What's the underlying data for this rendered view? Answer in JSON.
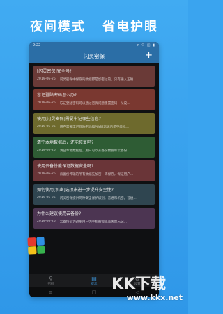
{
  "banner": {
    "left": "夜间模式",
    "right": "省电护眼"
  },
  "status": {
    "time": "9:22",
    "icons": "▾ ⌔ ◫ ▮"
  },
  "appbar": {
    "title": "闪灵密保",
    "add": "+"
  },
  "cards": [
    {
      "color": "#6a3a37",
      "question": "[闪灵密保]安全吗?",
      "date": "2019-06-26",
      "snippet": "闪灵密保中保存的数据都是加密过的，只有输入正确..."
    },
    {
      "color": "#7a3830",
      "question": "忘记登陆密码怎么办?",
      "date": "2019-06-26",
      "snippet": "忘记登陆密码可以通过密保问题重置密码，从设..."
    },
    {
      "color": "#6e6a2d",
      "question": "使用[闪灵密保]需要牢记哪些信息?",
      "date": "2019-06-26",
      "snippet": "用户需要牢记登陆密码和PIN码忘记后是不能找..."
    },
    {
      "color": "#2e5c34",
      "question": "清空本地数据后，还能恢复吗?",
      "date": "2019-06-26",
      "snippet": "清空本地数据后，用户可以从备份数据和云备份..."
    },
    {
      "color": "#6a3538",
      "question": "使用云备份能保证数据安全吗?",
      "date": "2019-06-26",
      "snippet": "云备份传输的所有数据先加密，再保存，保证用户..."
    },
    {
      "color": "#2f4550",
      "question": "如何使用[机密]选项来进一步提升安全性?",
      "date": "2019-06-26",
      "snippet": "闪灵密保提供两种安全保护级别：普通和机密。普通..."
    },
    {
      "color": "#4c3552",
      "question": "为什么建议使用云备份?",
      "date": "2019-06-26",
      "snippet": "云备份是为避免用户因手机被锁或丢失而忘记..."
    }
  ],
  "nav": [
    {
      "label": "密码",
      "icon": "person-icon",
      "glyph": "⚲",
      "active": false
    },
    {
      "label": "提示",
      "icon": "list-icon",
      "glyph": "▤",
      "active": true
    },
    {
      "label": "设置",
      "icon": "gear-icon",
      "glyph": "⚙",
      "active": false
    }
  ],
  "sysbar": {
    "menu": "≡",
    "home": "□",
    "back": "◁"
  },
  "logo_colors": [
    "#e5392f",
    "#2f8fe3",
    "#f4c21a",
    "#37b24d"
  ],
  "watermark": {
    "text": "www.kkx.net",
    "mark": "KK下载"
  }
}
